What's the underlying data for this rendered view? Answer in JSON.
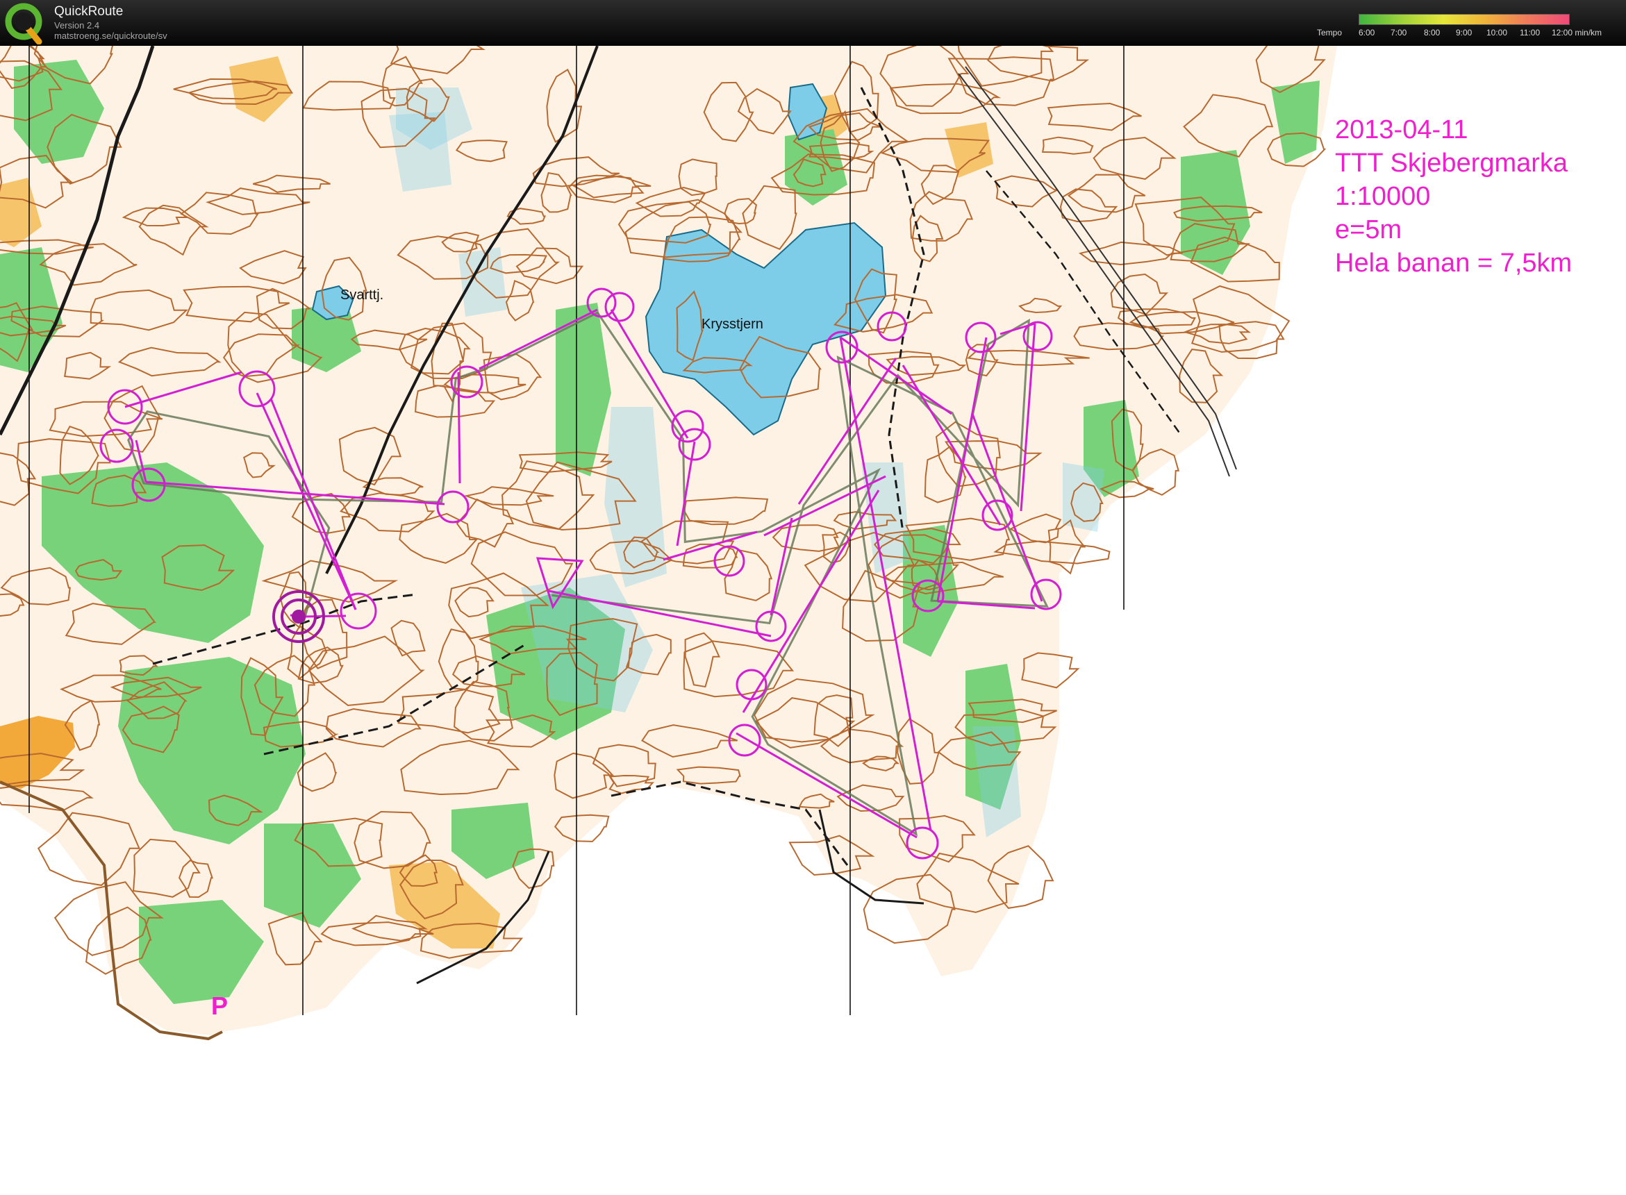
{
  "app": {
    "name": "QuickRoute",
    "version": "Version 2.4",
    "url": "matstroeng.se/quickroute/sv",
    "logo_letter": "Q"
  },
  "tempo_legend": {
    "label": "Tempo",
    "ticks": [
      "6:00",
      "7:00",
      "8:00",
      "9:00",
      "10:00",
      "11:00",
      "12:00 min/km"
    ],
    "colors": [
      "#3fb53f",
      "#9fd23a",
      "#e6e63a",
      "#f0b43a",
      "#f07a5a",
      "#f04a78"
    ]
  },
  "map_info": {
    "date": "2013-04-11",
    "event": "TTT Skjebergmarka",
    "scale": "1:10000",
    "contour": "e=5m",
    "course_length": "Hela banan = 7,5km",
    "text_color": "#ee1fcc"
  },
  "map_labels": {
    "lake_small": "Svarttj.",
    "lake_large": "Krysstjern",
    "parking": "P"
  },
  "map_colors": {
    "terrain": "#fdf2e4",
    "contour": "#b8692f",
    "vegetation": "#78d27a",
    "open_land": "#f6c46a",
    "water": "#7ecde8",
    "course": "#d21fd2",
    "gps_route": "#6a7a5a"
  }
}
